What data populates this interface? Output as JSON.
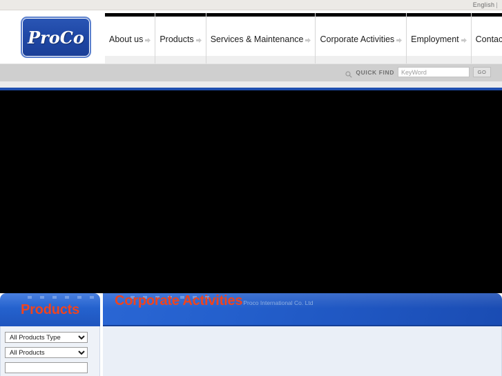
{
  "topbar": {
    "language_label": "English",
    "separator": "|"
  },
  "brand": {
    "logo_text": "ProCo"
  },
  "nav": {
    "items": [
      {
        "label": "About us",
        "icon": "chevron-right-icon"
      },
      {
        "label": "Products",
        "icon": "chevron-right-icon"
      },
      {
        "label": "Services & Maintenance",
        "icon": "chevron-right-icon"
      },
      {
        "label": "Corporate Activities",
        "icon": "chevron-right-icon"
      },
      {
        "label": "Employment",
        "icon": "chevron-right-icon"
      },
      {
        "label": "Contact us",
        "icon": "chevron-right-icon"
      }
    ]
  },
  "quickfind": {
    "icon": "search-icon",
    "label": "QUICK FIND",
    "input_value": "",
    "input_placeholder": "KeyWord",
    "go_label": "GO"
  },
  "panels": {
    "products": {
      "title": "Products",
      "filters": [
        {
          "selected": "All Products Type",
          "options": [
            "All Products Type"
          ]
        },
        {
          "selected": "All Products",
          "options": [
            "All Products"
          ]
        }
      ]
    },
    "corporate": {
      "title": "Corporate Activities",
      "subtitle": "Proco International Co. Ltd"
    }
  },
  "colors": {
    "brand_blue": "#1f55be",
    "accent_orange": "#f0441e",
    "divider_blue": "#1f4faf",
    "hero_black": "#000000",
    "panel_body": "#eef2f8"
  }
}
